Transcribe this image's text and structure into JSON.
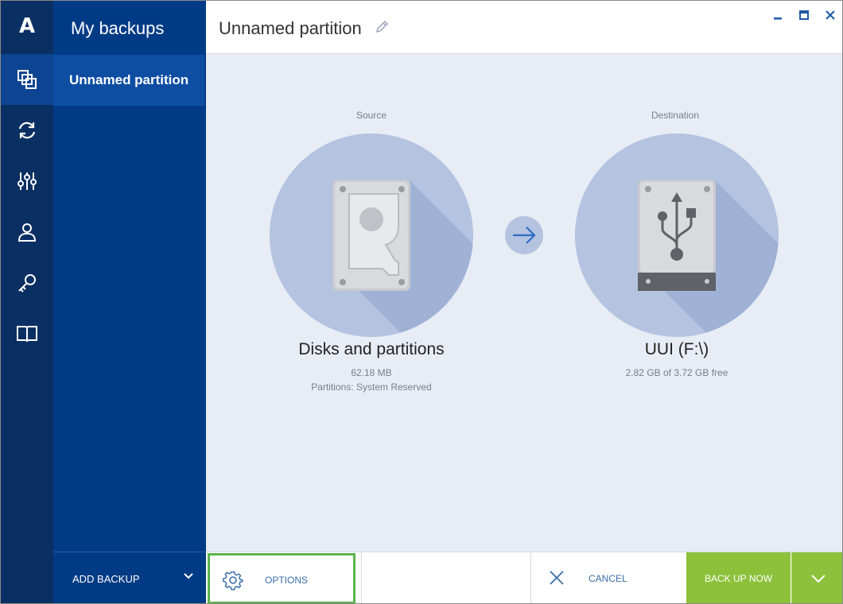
{
  "sidebar": {
    "logo": "A",
    "nav_icons": [
      "backup-icon",
      "sync-icon",
      "tools-icon",
      "account-icon",
      "key-icon",
      "book-icon"
    ]
  },
  "backups_panel": {
    "title": "My backups",
    "items": [
      {
        "label": "Unnamed partition",
        "selected": true
      }
    ],
    "add_backup_label": "ADD BACKUP"
  },
  "header": {
    "title": "Unnamed partition"
  },
  "source": {
    "heading": "Source",
    "name": "Disks and partitions",
    "size": "62.18 MB",
    "details": "Partitions: System Reserved"
  },
  "destination": {
    "heading": "Destination",
    "name": "UUI (F:\\)",
    "free": "2.82 GB of 3.72 GB free"
  },
  "actions": {
    "options_label": "OPTIONS",
    "cancel_label": "CANCEL",
    "backup_now_label": "BACK UP NOW"
  },
  "colors": {
    "rail_bg": "#0a2f63",
    "panel_bg": "#023b85",
    "selected_bg": "#0d4ea3",
    "accent_green": "#8dc13b",
    "focus_outline": "#5ab54b",
    "circle_fill": "#b3c3e0"
  }
}
